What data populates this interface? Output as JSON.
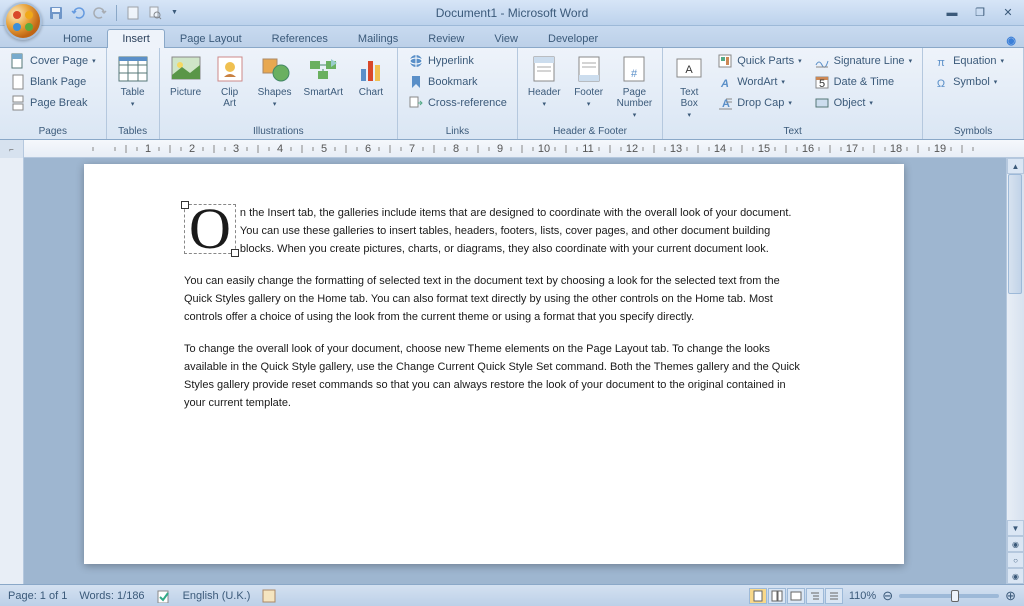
{
  "app": {
    "title": "Document1 - Microsoft Word"
  },
  "qat": {
    "save": "save-icon",
    "undo": "undo-icon",
    "redo": "redo-icon",
    "new": "new-doc-icon",
    "print_preview": "print-preview-icon"
  },
  "tabs": {
    "home": "Home",
    "insert": "Insert",
    "page_layout": "Page Layout",
    "references": "References",
    "mailings": "Mailings",
    "review": "Review",
    "view": "View",
    "developer": "Developer",
    "active": "insert"
  },
  "ribbon": {
    "pages": {
      "label": "Pages",
      "cover_page": "Cover Page",
      "blank_page": "Blank Page",
      "page_break": "Page Break"
    },
    "tables": {
      "label": "Tables",
      "table": "Table"
    },
    "illustrations": {
      "label": "Illustrations",
      "picture": "Picture",
      "clip_art": "Clip\nArt",
      "shapes": "Shapes",
      "smartart": "SmartArt",
      "chart": "Chart"
    },
    "links": {
      "label": "Links",
      "hyperlink": "Hyperlink",
      "bookmark": "Bookmark",
      "cross_ref": "Cross-reference"
    },
    "header_footer": {
      "label": "Header & Footer",
      "header": "Header",
      "footer": "Footer",
      "page_number": "Page\nNumber"
    },
    "text": {
      "label": "Text",
      "text_box": "Text\nBox",
      "quick_parts": "Quick Parts",
      "wordart": "WordArt",
      "drop_cap": "Drop Cap",
      "signature": "Signature Line",
      "date_time": "Date & Time",
      "object": "Object"
    },
    "symbols": {
      "label": "Symbols",
      "equation": "Equation",
      "symbol": "Symbol"
    }
  },
  "document": {
    "drop_cap": "O",
    "p1": "n the Insert tab, the galleries include items that are designed to coordinate with the overall look of your document. You can use these galleries to insert tables, headers, footers, lists, cover pages, and other document building blocks. When you create pictures, charts, or diagrams, they also coordinate with your current document look.",
    "p2": "You can easily change the formatting of selected text in the document text by choosing a look for the selected text from the Quick Styles gallery on the Home tab. You can also format text directly by using the other controls on the Home tab. Most controls offer a choice of using the look from the current theme or using a format that you specify directly.",
    "p3": "To change the overall look of your document, choose new Theme elements on the Page Layout tab. To change the looks available in the Quick Style gallery, use the Change Current Quick Style Set command. Both the Themes gallery and the Quick Styles gallery provide reset commands so that you can always restore the look of your document to the original contained in your current template."
  },
  "status": {
    "page": "Page: 1 of 1",
    "words": "Words: 1/186",
    "lang": "English (U.K.)",
    "zoom": "110%"
  }
}
